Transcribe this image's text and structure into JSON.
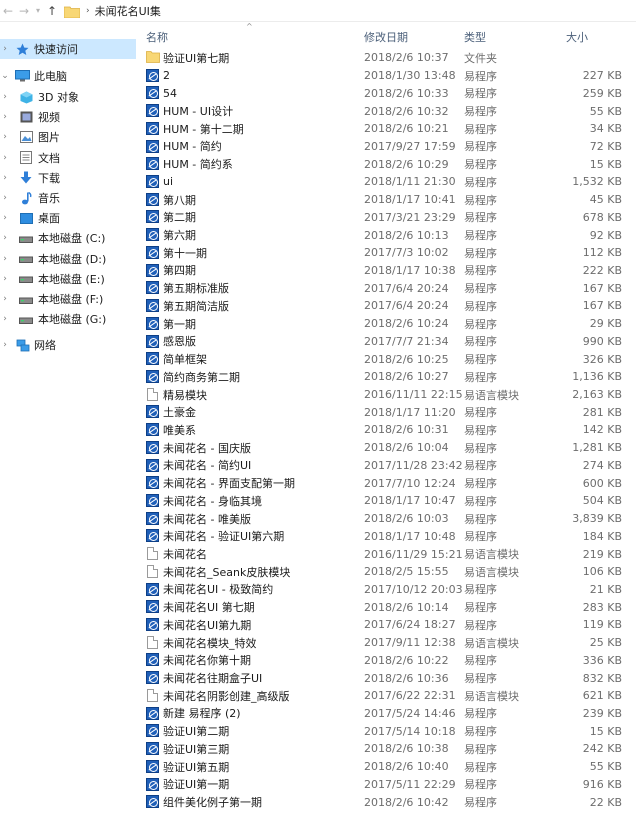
{
  "address_bar": {
    "back_icon": "arrow-left-icon",
    "forward_icon": "arrow-right-icon",
    "dropdown_icon": "chevron-down-icon",
    "up_icon": "arrow-up-icon",
    "path": "未闻花名UI集"
  },
  "sidebar": {
    "quick_access": "快速访问",
    "this_pc": "此电脑",
    "items": [
      {
        "label": "3D 对象",
        "icon": "3d-objects-icon"
      },
      {
        "label": "视频",
        "icon": "video-icon"
      },
      {
        "label": "图片",
        "icon": "pictures-icon"
      },
      {
        "label": "文档",
        "icon": "documents-icon"
      },
      {
        "label": "下载",
        "icon": "download-icon"
      },
      {
        "label": "音乐",
        "icon": "music-icon"
      },
      {
        "label": "桌面",
        "icon": "desktop-icon"
      },
      {
        "label": "本地磁盘 (C:)",
        "icon": "drive-icon"
      },
      {
        "label": "本地磁盘 (D:)",
        "icon": "drive-icon"
      },
      {
        "label": "本地磁盘 (E:)",
        "icon": "drive-icon"
      },
      {
        "label": "本地磁盘 (F:)",
        "icon": "drive-icon"
      },
      {
        "label": "本地磁盘 (G:)",
        "icon": "drive-icon"
      }
    ],
    "network": "网络"
  },
  "columns": {
    "name": "名称",
    "date": "修改日期",
    "type": "类型",
    "size": "大小"
  },
  "files": [
    {
      "name": "验证UI第七期",
      "date": "2018/2/6 10:37",
      "type": "文件夹",
      "size": "",
      "icon": "folder"
    },
    {
      "name": "2",
      "date": "2018/1/30 13:48",
      "type": "易程序",
      "size": "227 KB",
      "icon": "exe"
    },
    {
      "name": "54",
      "date": "2018/2/6 10:33",
      "type": "易程序",
      "size": "259 KB",
      "icon": "exe"
    },
    {
      "name": "HUM - UI设计",
      "date": "2018/2/6 10:32",
      "type": "易程序",
      "size": "55 KB",
      "icon": "exe"
    },
    {
      "name": "HUM - 第十二期",
      "date": "2018/2/6 10:21",
      "type": "易程序",
      "size": "34 KB",
      "icon": "exe"
    },
    {
      "name": "HUM - 简约",
      "date": "2017/9/27 17:59",
      "type": "易程序",
      "size": "72 KB",
      "icon": "exe"
    },
    {
      "name": "HUM - 简约系",
      "date": "2018/2/6 10:29",
      "type": "易程序",
      "size": "15 KB",
      "icon": "exe"
    },
    {
      "name": "ui",
      "date": "2018/1/11 21:30",
      "type": "易程序",
      "size": "1,532 KB",
      "icon": "exe"
    },
    {
      "name": "第八期",
      "date": "2018/1/17 10:41",
      "type": "易程序",
      "size": "45 KB",
      "icon": "exe"
    },
    {
      "name": "第二期",
      "date": "2017/3/21 23:29",
      "type": "易程序",
      "size": "678 KB",
      "icon": "exe"
    },
    {
      "name": "第六期",
      "date": "2018/2/6 10:13",
      "type": "易程序",
      "size": "92 KB",
      "icon": "exe"
    },
    {
      "name": "第十一期",
      "date": "2017/7/3 10:02",
      "type": "易程序",
      "size": "112 KB",
      "icon": "exe"
    },
    {
      "name": "第四期",
      "date": "2018/1/17 10:38",
      "type": "易程序",
      "size": "222 KB",
      "icon": "exe"
    },
    {
      "name": "第五期标准版",
      "date": "2017/6/4 20:24",
      "type": "易程序",
      "size": "167 KB",
      "icon": "exe"
    },
    {
      "name": "第五期简洁版",
      "date": "2017/6/4 20:24",
      "type": "易程序",
      "size": "167 KB",
      "icon": "exe"
    },
    {
      "name": "第一期",
      "date": "2018/2/6 10:24",
      "type": "易程序",
      "size": "29 KB",
      "icon": "exe"
    },
    {
      "name": "感恩版",
      "date": "2017/7/7 21:34",
      "type": "易程序",
      "size": "990 KB",
      "icon": "exe"
    },
    {
      "name": "简单框架",
      "date": "2018/2/6 10:25",
      "type": "易程序",
      "size": "326 KB",
      "icon": "exe"
    },
    {
      "name": "简约商务第二期",
      "date": "2018/2/6 10:27",
      "type": "易程序",
      "size": "1,136 KB",
      "icon": "exe"
    },
    {
      "name": "精易模块",
      "date": "2016/11/11 22:15",
      "type": "易语言模块",
      "size": "2,163 KB",
      "icon": "module"
    },
    {
      "name": "土豪金",
      "date": "2018/1/17 11:20",
      "type": "易程序",
      "size": "281 KB",
      "icon": "exe"
    },
    {
      "name": "唯美系",
      "date": "2018/2/6 10:31",
      "type": "易程序",
      "size": "142 KB",
      "icon": "exe"
    },
    {
      "name": "未闻花名 - 国庆版",
      "date": "2018/2/6 10:04",
      "type": "易程序",
      "size": "1,281 KB",
      "icon": "exe"
    },
    {
      "name": "未闻花名 - 简约UI",
      "date": "2017/11/28 23:42",
      "type": "易程序",
      "size": "274 KB",
      "icon": "exe"
    },
    {
      "name": "未闻花名 - 界面支配第一期",
      "date": "2017/7/10 12:24",
      "type": "易程序",
      "size": "600 KB",
      "icon": "exe"
    },
    {
      "name": "未闻花名 - 身临其境",
      "date": "2018/1/17 10:47",
      "type": "易程序",
      "size": "504 KB",
      "icon": "exe"
    },
    {
      "name": "未闻花名 - 唯美版",
      "date": "2018/2/6 10:03",
      "type": "易程序",
      "size": "3,839 KB",
      "icon": "exe"
    },
    {
      "name": "未闻花名 - 验证UI第六期",
      "date": "2018/1/17 10:48",
      "type": "易程序",
      "size": "184 KB",
      "icon": "exe"
    },
    {
      "name": "未闻花名",
      "date": "2016/11/29 15:21",
      "type": "易语言模块",
      "size": "219 KB",
      "icon": "module"
    },
    {
      "name": "未闻花名_Seank皮肤模块",
      "date": "2018/2/5 15:55",
      "type": "易语言模块",
      "size": "106 KB",
      "icon": "module"
    },
    {
      "name": "未闻花名UI - 极致简约",
      "date": "2017/10/12 20:03",
      "type": "易程序",
      "size": "21 KB",
      "icon": "exe"
    },
    {
      "name": "未闻花名UI 第七期",
      "date": "2018/2/6 10:14",
      "type": "易程序",
      "size": "283 KB",
      "icon": "exe"
    },
    {
      "name": "未闻花名UI第九期",
      "date": "2017/6/24 18:27",
      "type": "易程序",
      "size": "119 KB",
      "icon": "exe"
    },
    {
      "name": "未闻花名模块_特效",
      "date": "2017/9/11 12:38",
      "type": "易语言模块",
      "size": "25 KB",
      "icon": "module"
    },
    {
      "name": "未闻花名你第十期",
      "date": "2018/2/6 10:22",
      "type": "易程序",
      "size": "336 KB",
      "icon": "exe"
    },
    {
      "name": "未闻花名往期盒子UI",
      "date": "2018/2/6 10:36",
      "type": "易程序",
      "size": "832 KB",
      "icon": "exe"
    },
    {
      "name": "未闻花名阴影创建_高级版",
      "date": "2017/6/22 22:31",
      "type": "易语言模块",
      "size": "621 KB",
      "icon": "module"
    },
    {
      "name": "新建 易程序 (2)",
      "date": "2017/5/24 14:46",
      "type": "易程序",
      "size": "239 KB",
      "icon": "exe"
    },
    {
      "name": "验证UI第二期",
      "date": "2017/5/14 10:18",
      "type": "易程序",
      "size": "15 KB",
      "icon": "exe"
    },
    {
      "name": "验证UI第三期",
      "date": "2018/2/6 10:38",
      "type": "易程序",
      "size": "242 KB",
      "icon": "exe"
    },
    {
      "name": "验证UI第五期",
      "date": "2018/2/6 10:40",
      "type": "易程序",
      "size": "55 KB",
      "icon": "exe"
    },
    {
      "name": "验证UI第一期",
      "date": "2017/5/11 22:29",
      "type": "易程序",
      "size": "916 KB",
      "icon": "exe"
    },
    {
      "name": "组件美化例子第一期",
      "date": "2018/2/6 10:42",
      "type": "易程序",
      "size": "22 KB",
      "icon": "exe"
    }
  ]
}
